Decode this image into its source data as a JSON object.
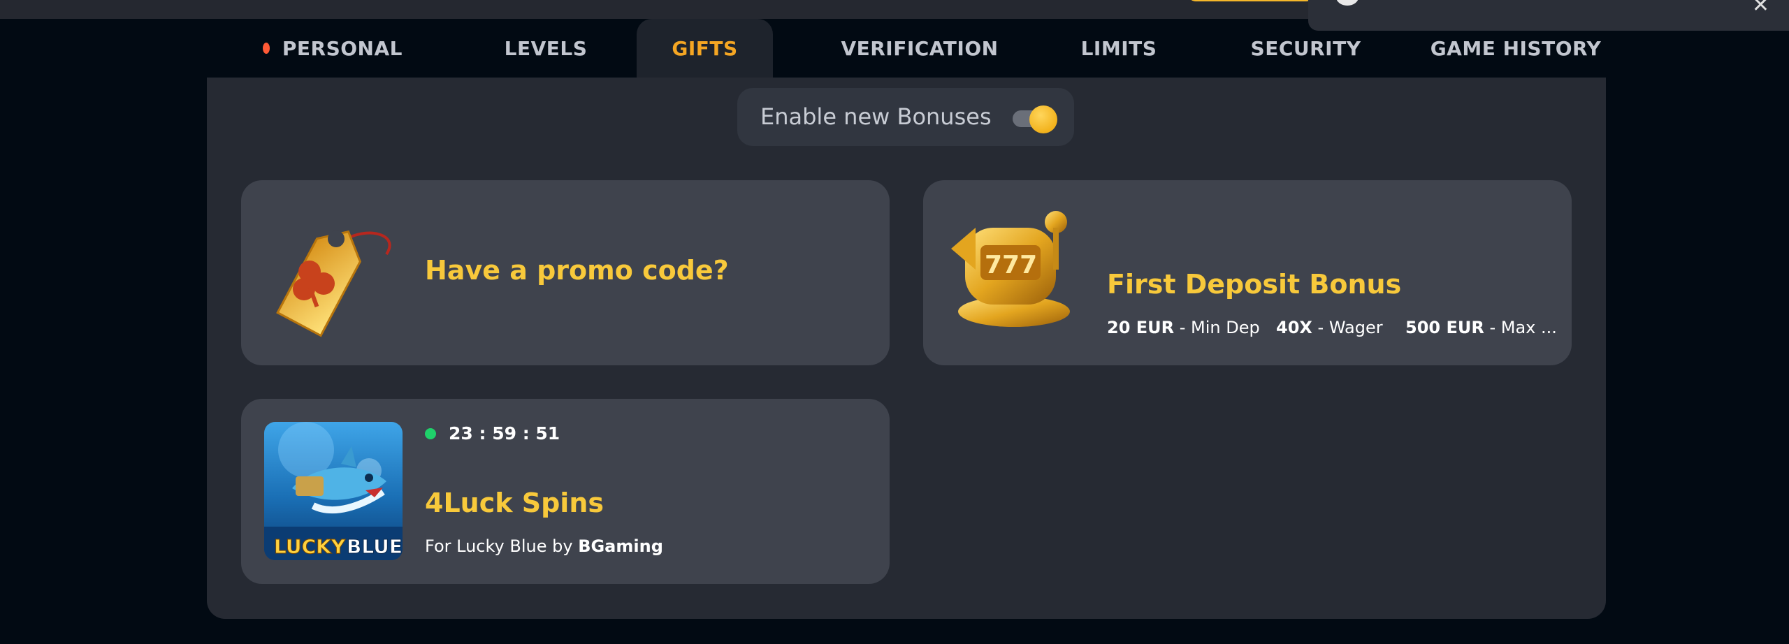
{
  "tabs": [
    {
      "label": "PERSONAL",
      "has_alert": true
    },
    {
      "label": "LEVELS"
    },
    {
      "label": "GIFTS",
      "active": true
    },
    {
      "label": "VERIFICATION"
    },
    {
      "label": "LIMITS"
    },
    {
      "label": "SECURITY"
    },
    {
      "label": "GAME HISTORY"
    }
  ],
  "toggle": {
    "label": "Enable new Bonuses",
    "enabled": true
  },
  "promo": {
    "title": "Have a promo code?"
  },
  "deposit": {
    "title": "First Deposit Bonus",
    "min_dep_value": "20 EUR",
    "min_dep_label": "- Min Dep",
    "wager_value": "40X",
    "wager_label": "- Wager",
    "max_value": "500 EUR",
    "max_label": "- Max ..."
  },
  "spins": {
    "timer": "23 : 59 : 51",
    "title": "4Luck Spins",
    "game_prefix": "For Lucky Blue by",
    "provider": "BGaming",
    "thumb_title_left": "LUCKY",
    "thumb_title_right": "BLUE"
  },
  "colors": {
    "accent_gold": "#f8c93b",
    "active_tab": "#f5a623",
    "alert_dot": "#ff5a36",
    "live_dot": "#1fd16a"
  },
  "icons": {
    "promo": "tag-clover-icon",
    "deposit": "slot-machine-icon",
    "close": "close-icon"
  }
}
